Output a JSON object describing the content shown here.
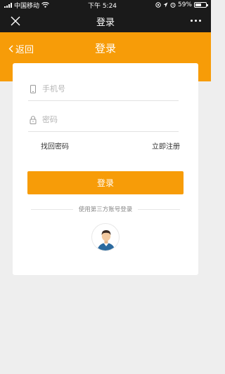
{
  "status_bar": {
    "carrier": "中国移动",
    "time": "下午 5:24",
    "battery": "59%",
    "battery_level": 0.59
  },
  "title_bar": {
    "title": "登录"
  },
  "header": {
    "back_label": "返回",
    "title": "登录"
  },
  "form": {
    "phone_placeholder": "手机号",
    "phone_value": "",
    "password_placeholder": "密码",
    "password_value": "",
    "forgot_password": "找回密码",
    "register": "立即注册",
    "login_button": "登录",
    "third_party_label": "使用第三方账号登录"
  },
  "colors": {
    "accent": "#f79c08",
    "bar": "#1a1a1a",
    "background": "#eeeeee"
  }
}
